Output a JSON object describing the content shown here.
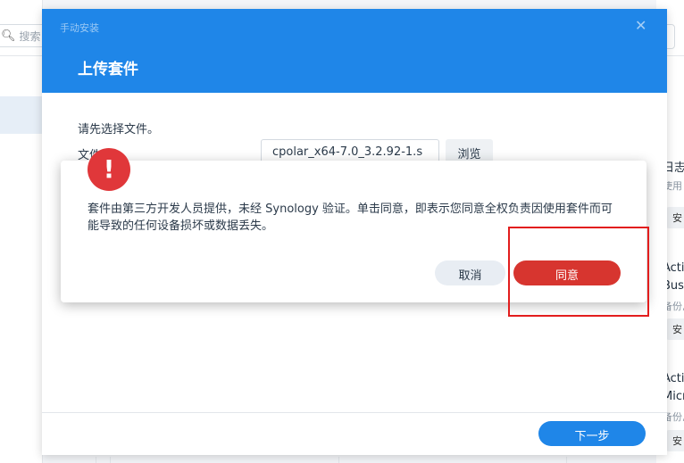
{
  "background": {
    "search_placeholder": "搜索",
    "search_icon": "search-icon",
    "right_cards": [
      {
        "title": "日志",
        "subtitle": "使用",
        "button": "安"
      },
      {
        "title_line1": "Acti",
        "title_line2": "Bus",
        "subtitle": "备份,",
        "button": "安"
      },
      {
        "title_line1": "Acti",
        "title_line2": "Micr",
        "subtitle": "备份,",
        "button": "安"
      }
    ]
  },
  "dialog": {
    "app_title": "手动安装",
    "close_icon": "close-icon",
    "title": "上传套件",
    "prompt": "请先选择文件。",
    "file_label": "文件",
    "file_value": "cpolar_x64-7.0_3.2.92-1.s",
    "browse_label": "浏览",
    "next_label": "下一步",
    "header_color": "#1f86e8"
  },
  "alert": {
    "icon": "exclamation-icon",
    "icon_glyph": "!",
    "message": "套件由第三方开发人员提供，未经 Synology 验证。单击同意，即表示您同意全权负责因使用套件而可能导致的任何设备损坏或数据丢失。",
    "cancel_label": "取消",
    "agree_label": "同意",
    "agree_color": "#d7352f",
    "highlight_color": "#e21d1d"
  }
}
